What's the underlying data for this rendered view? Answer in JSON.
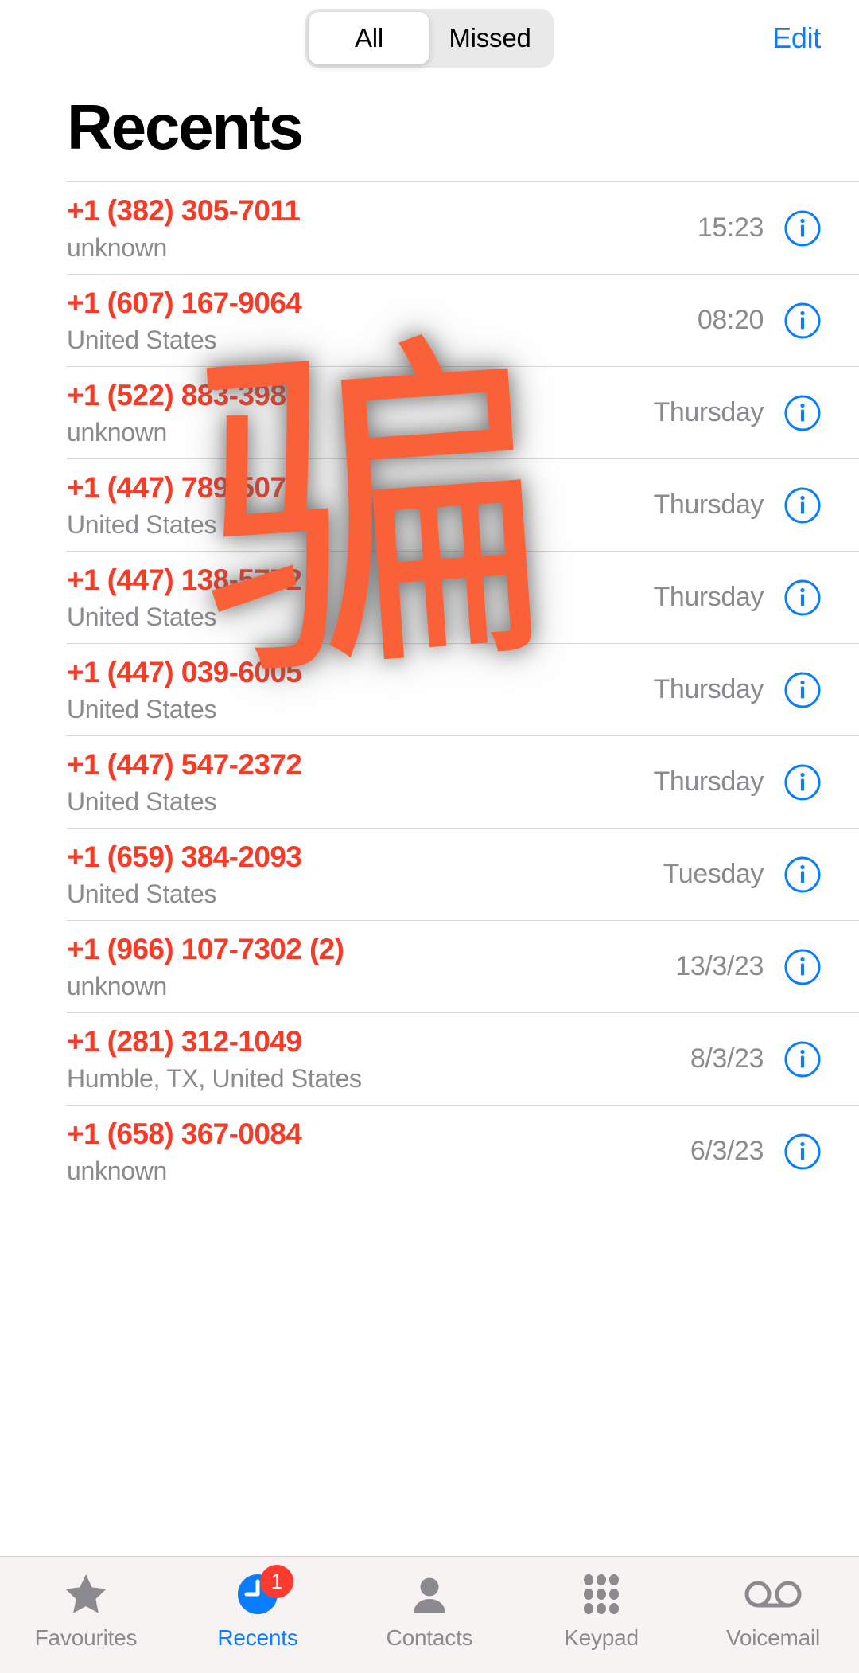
{
  "topbar": {
    "segments": [
      {
        "label": "All",
        "active": true
      },
      {
        "label": "Missed",
        "active": false
      }
    ],
    "edit_label": "Edit"
  },
  "page_title": "Recents",
  "accent_colors": {
    "red_number": "#f93a26",
    "blue_link": "#0a7cff",
    "gray_secondary": "#8b8b8f",
    "badge_red": "#ff3b30",
    "watermark_orange": "#fa6138",
    "segmented_track": "#e9e9ea",
    "tabbar_bg": "#f7f3f3",
    "separator": "#d6d6d8"
  },
  "watermark": {
    "text": "骗",
    "meaning": "scam-watermark"
  },
  "calls": [
    {
      "number": "+1 (382) 305-7011",
      "location": "unknown",
      "time": "15:23"
    },
    {
      "number": "+1 (607) 167-9064",
      "location": "United States",
      "time": "08:20"
    },
    {
      "number": "+1 (522) 883-3986",
      "location": "unknown",
      "time": "Thursday"
    },
    {
      "number": "+1 (447) 789-5070",
      "location": "United States",
      "time": "Thursday"
    },
    {
      "number": "+1 (447) 138-5772",
      "location": "United States",
      "time": "Thursday"
    },
    {
      "number": "+1 (447) 039-6005",
      "location": "United States",
      "time": "Thursday"
    },
    {
      "number": "+1 (447) 547-2372",
      "location": "United States",
      "time": "Thursday"
    },
    {
      "number": "+1 (659) 384-2093",
      "location": "United States",
      "time": "Tuesday"
    },
    {
      "number": "+1 (966) 107-7302 (2)",
      "location": "unknown",
      "time": "13/3/23"
    },
    {
      "number": "+1 (281) 312-1049",
      "location": "Humble, TX, United States",
      "time": "8/3/23"
    },
    {
      "number": "+1 (658) 367-0084",
      "location": "unknown",
      "time": "6/3/23"
    }
  ],
  "tabbar": {
    "items": [
      {
        "label": "Favourites",
        "icon": "star-icon",
        "active": false,
        "badge": null
      },
      {
        "label": "Recents",
        "icon": "clock-icon",
        "active": true,
        "badge": "1"
      },
      {
        "label": "Contacts",
        "icon": "person-icon",
        "active": false,
        "badge": null
      },
      {
        "label": "Keypad",
        "icon": "keypad-icon",
        "active": false,
        "badge": null
      },
      {
        "label": "Voicemail",
        "icon": "voicemail-icon",
        "active": false,
        "badge": null
      }
    ]
  }
}
